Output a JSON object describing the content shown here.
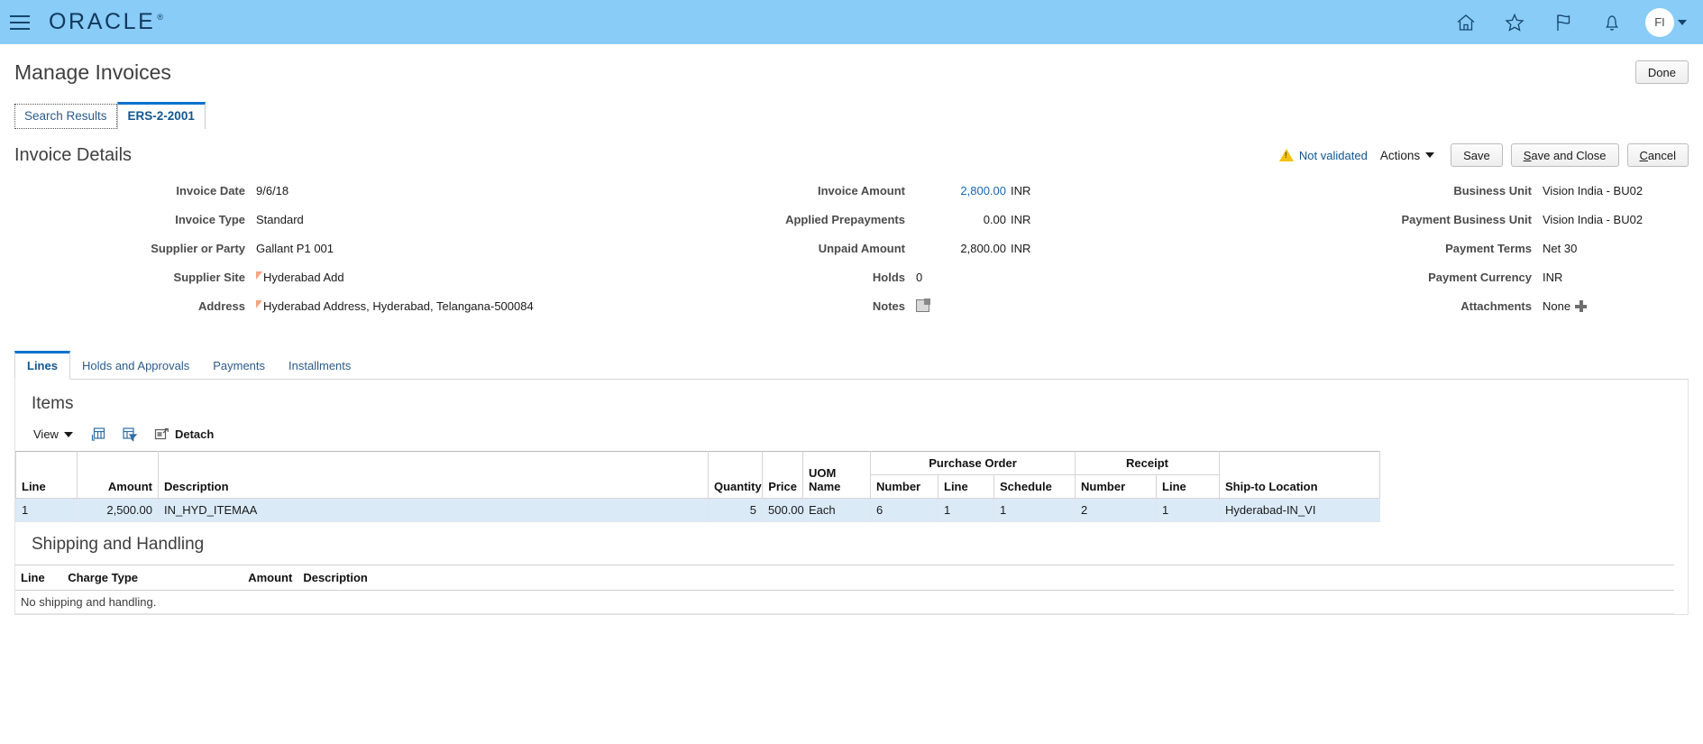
{
  "global": {
    "logo": "ORACLE",
    "menu_icon": "hamburger-icon",
    "icons": [
      "home-icon",
      "star-icon",
      "flag-icon",
      "bell-icon"
    ],
    "avatar_initials": "FI",
    "accent_color": "#88ccf7"
  },
  "page": {
    "title": "Manage Invoices",
    "done_label": "Done"
  },
  "breadcrumb_tabs": [
    {
      "label": "Search Results",
      "active": false
    },
    {
      "label": "ERS-2-2001",
      "active": true
    }
  ],
  "invoice_details": {
    "heading": "Invoice Details",
    "status": "Not validated",
    "status_icon": "warning-triangle-icon",
    "actions_label": "Actions",
    "buttons": {
      "save": "Save",
      "save_and_close": "Save and Close",
      "cancel": "Cancel"
    },
    "column1": [
      {
        "label": "Invoice Date",
        "value": "9/6/18"
      },
      {
        "label": "Invoice Type",
        "value": "Standard"
      },
      {
        "label": "Supplier or Party",
        "value": "Gallant P1 001"
      },
      {
        "label": "Supplier Site",
        "value": "Hyderabad Add",
        "flag": true
      },
      {
        "label": "Address",
        "value": "Hyderabad Address, Hyderabad, Telangana-500084",
        "flag": true
      }
    ],
    "column2": [
      {
        "label": "Invoice Amount",
        "value": "2,800.00",
        "currency": "INR",
        "link": true
      },
      {
        "label": "Applied Prepayments",
        "value": "0.00",
        "currency": "INR"
      },
      {
        "label": "Unpaid Amount",
        "value": "2,800.00",
        "currency": "INR"
      },
      {
        "label": "Holds",
        "value": "0"
      },
      {
        "label": "Notes",
        "value": "",
        "icon": "notes-icon"
      }
    ],
    "column3": [
      {
        "label": "Business Unit",
        "value": "Vision India - BU02"
      },
      {
        "label": "Payment Business Unit",
        "value": "Vision India - BU02"
      },
      {
        "label": "Payment Terms",
        "value": "Net 30"
      },
      {
        "label": "Payment Currency",
        "value": "INR"
      },
      {
        "label": "Attachments",
        "value": "None",
        "icon": "plus-icon"
      }
    ]
  },
  "sub_tabs": [
    {
      "label": "Lines",
      "active": true
    },
    {
      "label": "Holds and Approvals",
      "active": false
    },
    {
      "label": "Payments",
      "active": false
    },
    {
      "label": "Installments",
      "active": false
    }
  ],
  "items": {
    "title": "Items",
    "toolbar": {
      "view_label": "View",
      "detach_label": "Detach",
      "icons": [
        "columns-icon",
        "filter-icon",
        "detach-icon"
      ]
    },
    "group_headers": {
      "purchase_order": "Purchase Order",
      "receipt": "Receipt"
    },
    "columns": {
      "line": "Line",
      "amount": "Amount",
      "description": "Description",
      "quantity": "Quantity",
      "price": "Price",
      "uom_name": "UOM Name",
      "po_number": "Number",
      "po_line": "Line",
      "po_schedule": "Schedule",
      "rcpt_number": "Number",
      "rcpt_line": "Line",
      "ship_to_location": "Ship-to Location"
    },
    "rows": [
      {
        "line": "1",
        "amount": "2,500.00",
        "description": "IN_HYD_ITEMAA",
        "quantity": "5",
        "price": "500.00",
        "uom_name": "Each",
        "po_number": "6",
        "po_line": "1",
        "po_schedule": "1",
        "rcpt_number": "2",
        "rcpt_line": "1",
        "ship_to_location": "Hyderabad-IN_VI"
      }
    ]
  },
  "shipping": {
    "title": "Shipping and Handling",
    "columns": {
      "line": "Line",
      "charge_type": "Charge Type",
      "amount": "Amount",
      "description": "Description"
    },
    "empty_message": "No shipping and handling."
  }
}
